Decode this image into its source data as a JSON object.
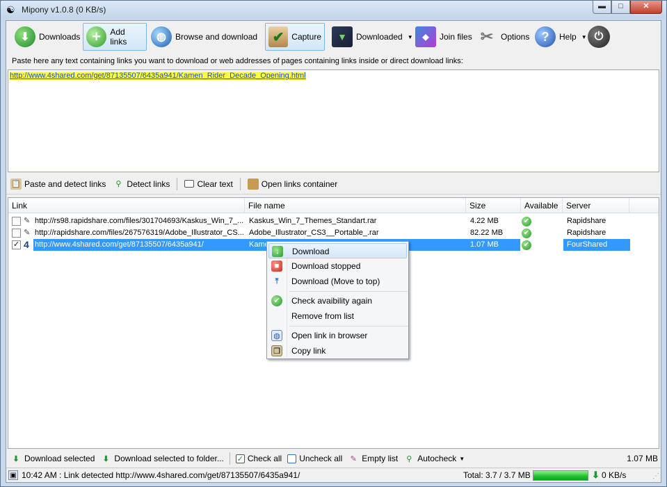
{
  "window": {
    "title": "Mipony v1.0.8 (0 KB/s)",
    "controls": {
      "minimize": "▬",
      "maximize": "□",
      "close": "✕"
    }
  },
  "toolbar": {
    "downloads": "Downloads",
    "add_links": "Add links",
    "browse_and_download": "Browse and download",
    "capture": "Capture",
    "downloaded": "Downloaded",
    "join_files": "Join files",
    "options": "Options",
    "help": "Help"
  },
  "input_area": {
    "hint": "Paste here any text containing links you want to download or web addresses of pages containing links inside or direct download links:",
    "text": "http://www.4shared.com/get/87135507/6435a941/Kamen_Rider_Decade_Opening.html"
  },
  "actions": {
    "paste_and_detect": "Paste and detect links",
    "detect_links": "Detect links",
    "clear_text": "Clear text",
    "open_links_container": "Open links container"
  },
  "table": {
    "columns": [
      "Link",
      "File name",
      "Size",
      "Available",
      "Server"
    ],
    "rows": [
      {
        "checked": false,
        "link": "http://rs98.rapidshare.com/files/301704693/Kaskus_Win_7_...",
        "file_name": "Kaskus_Win_7_Themes_Standart.rar",
        "size": "4.22 MB",
        "server": "Rapidshare"
      },
      {
        "checked": false,
        "link": "http://rapidshare.com/files/267576319/Adobe_Illustrator_CS...",
        "file_name": "Adobe_Illustrator_CS3__Portable_.rar",
        "size": "82.22 MB",
        "server": "Rapidshare"
      },
      {
        "checked": true,
        "link": "http://www.4shared.com/get/87135507/6435a941/",
        "file_name": "Kamen_Rider_Decade_Opening...",
        "size": "1.07 MB",
        "server": "FourShared"
      }
    ]
  },
  "context_menu": {
    "items": [
      {
        "label": "Download",
        "icon": "download-icon"
      },
      {
        "label": "Download stopped",
        "icon": "stop-icon"
      },
      {
        "label": "Download (Move to top)",
        "icon": "move-top-icon"
      },
      {
        "label": "Check avaibility again",
        "icon": "check-icon"
      },
      {
        "label": "Remove from list",
        "icon": ""
      },
      {
        "label": "Open link in browser",
        "icon": "browser-icon"
      },
      {
        "label": "Copy link",
        "icon": "copy-icon"
      }
    ]
  },
  "bottom_bar": {
    "download_selected": "Download selected",
    "download_selected_to_folder": "Download selected to folder...",
    "check_all": "Check all",
    "uncheck_all": "Uncheck all",
    "empty_list": "Empty list",
    "autocheck": "Autocheck",
    "total_size": "1.07 MB"
  },
  "status": {
    "message": "10:42 AM : Link detected http://www.4shared.com/get/87135507/6435a941/",
    "total": "Total: 3.7 / 3.7 MB",
    "progress": 1.0,
    "speed": "0 KB/s"
  },
  "colors": {
    "selection": "#3399ff",
    "highlight_text_bg": "#ffff40",
    "link_text": "#1f4faa",
    "progress_green": "#1fbf2e"
  }
}
